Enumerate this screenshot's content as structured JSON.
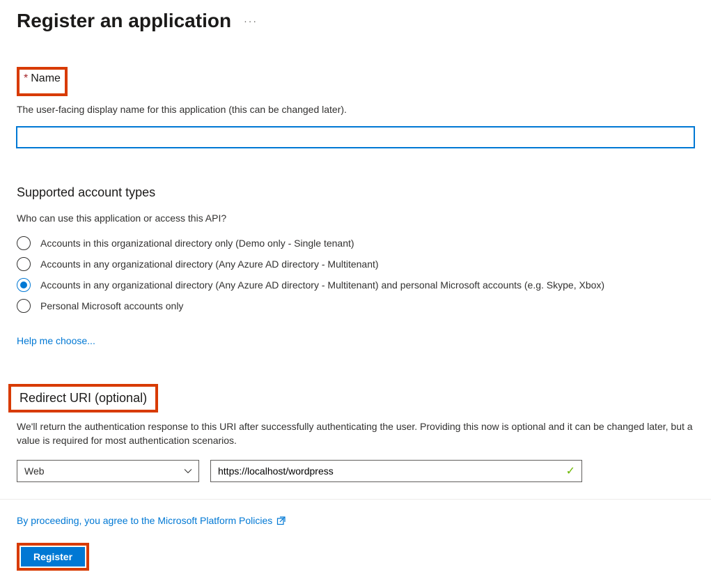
{
  "header": {
    "title": "Register an application"
  },
  "nameSection": {
    "label": "Name",
    "desc": "The user-facing display name for this application (this can be changed later).",
    "value": ""
  },
  "accountTypes": {
    "heading": "Supported account types",
    "question": "Who can use this application or access this API?",
    "options": [
      {
        "label": "Accounts in this organizational directory only (Demo only - Single tenant)",
        "selected": false
      },
      {
        "label": "Accounts in any organizational directory (Any Azure AD directory - Multitenant)",
        "selected": false
      },
      {
        "label": "Accounts in any organizational directory (Any Azure AD directory - Multitenant) and personal Microsoft accounts (e.g. Skype, Xbox)",
        "selected": true
      },
      {
        "label": "Personal Microsoft accounts only",
        "selected": false
      }
    ],
    "helpLink": "Help me choose..."
  },
  "redirect": {
    "heading": "Redirect URI (optional)",
    "desc": "We'll return the authentication response to this URI after successfully authenticating the user. Providing this now is optional and it can be changed later, but a value is required for most authentication scenarios.",
    "platformSelected": "Web",
    "uriValue": "https://localhost/wordpress"
  },
  "footer": {
    "agreeText": "By proceeding, you agree to the Microsoft Platform Policies",
    "registerLabel": "Register"
  }
}
